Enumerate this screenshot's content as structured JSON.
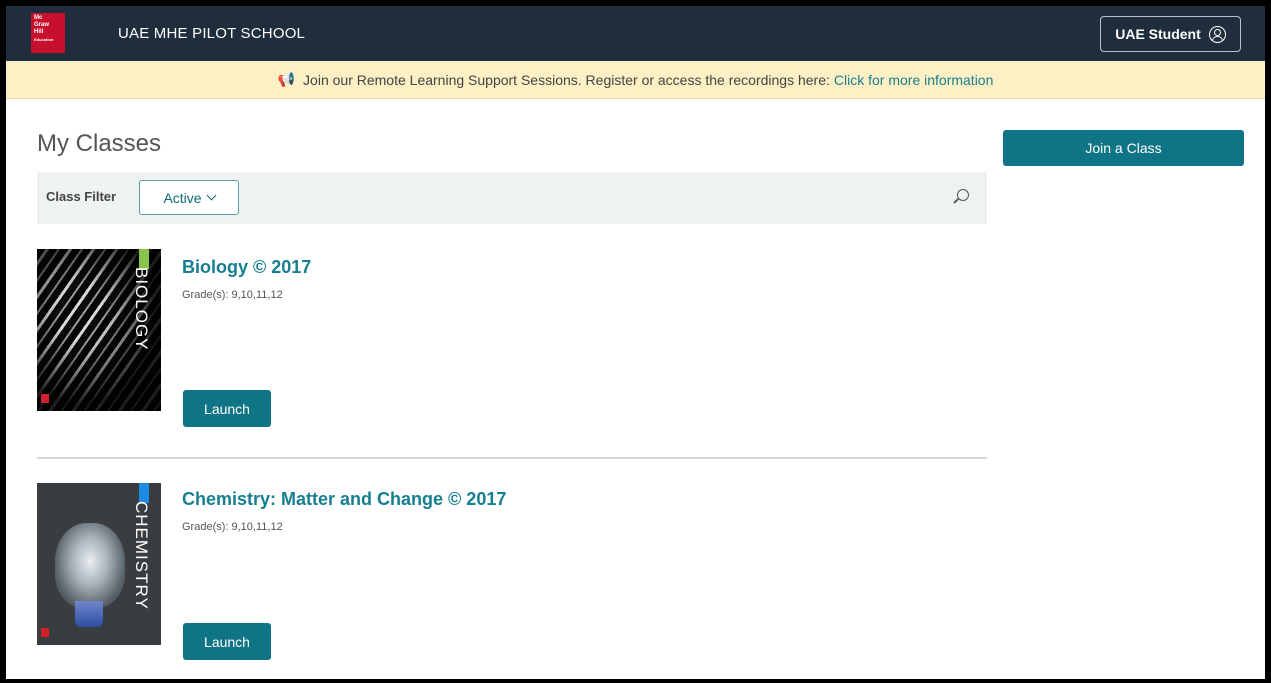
{
  "header": {
    "logo_lines": [
      "Mc",
      "Graw",
      "Hill",
      "Education"
    ],
    "school_name": "UAE MHE PILOT SCHOOL",
    "user_label": "UAE Student"
  },
  "banner": {
    "text": "Join our Remote Learning Support Sessions. Register or access the recordings here:",
    "link_text": "Click for more information"
  },
  "main": {
    "title": "My Classes",
    "join_button": "Join a Class",
    "filter": {
      "label": "Class Filter",
      "selected": "Active"
    },
    "classes": [
      {
        "title": "Biology © 2017",
        "grades": "Grade(s): 9,10,11,12",
        "cover_text": "BIOLOGY",
        "launch_label": "Launch"
      },
      {
        "title": "Chemistry: Matter and Change © 2017",
        "grades": "Grade(s): 9,10,11,12",
        "cover_text": "CHEMISTRY",
        "launch_label": "Launch"
      }
    ]
  },
  "colors": {
    "topbar": "#1f2d3d",
    "banner": "#fdf0c4",
    "accent": "#0f7485",
    "link": "#1a7f8e",
    "biology_accent": "#8bc34a",
    "chemistry_accent": "#1e88e5"
  }
}
